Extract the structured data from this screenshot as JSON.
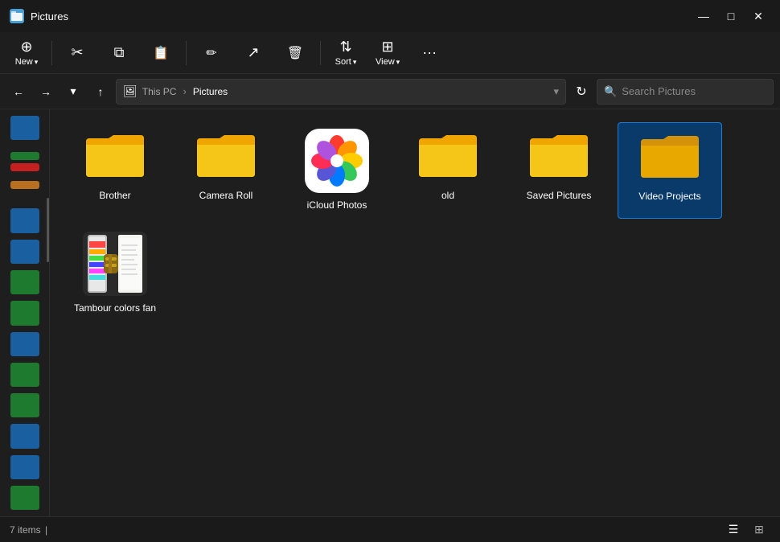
{
  "titleBar": {
    "title": "Pictures",
    "iconColor": "#4a9fd4",
    "controls": {
      "minimize": "—",
      "maximize": "□",
      "close": "✕"
    }
  },
  "toolbar": {
    "new_label": "New",
    "new_arrow": "▾",
    "cut_icon": "✂",
    "copy_icon": "⧉",
    "paste_icon": "📋",
    "rename_icon": "✏",
    "share_icon": "↗",
    "delete_icon": "🗑",
    "sort_label": "Sort",
    "sort_arrow": "▾",
    "view_label": "View",
    "view_arrow": "▾",
    "more_icon": "···"
  },
  "navBar": {
    "back_label": "←",
    "forward_label": "→",
    "recent_label": "▾",
    "up_label": "↑",
    "path": {
      "icon": "🖼",
      "parts": [
        "This PC",
        "Pictures"
      ]
    },
    "dropdown_arrow": "▾",
    "refresh_icon": "↻",
    "search_placeholder": "Search Pictures"
  },
  "sidebar": {
    "items": [
      {
        "icon": "📌",
        "name": "quick-access-1"
      },
      {
        "icon": "🏠",
        "name": "home"
      },
      {
        "icon": "⭐",
        "name": "favorites"
      },
      {
        "icon": "✕",
        "name": "close-item"
      },
      {
        "icon": "📁",
        "name": "folder"
      },
      {
        "icon": "🖥",
        "name": "desktop"
      },
      {
        "icon": "⬇",
        "name": "downloads"
      },
      {
        "icon": "📄",
        "name": "documents"
      },
      {
        "icon": "🖼",
        "name": "pictures"
      },
      {
        "icon": "🎵",
        "name": "music"
      },
      {
        "icon": "🎬",
        "name": "videos"
      },
      {
        "icon": "💾",
        "name": "this-pc"
      }
    ]
  },
  "files": [
    {
      "name": "Brother",
      "type": "folder",
      "selected": false
    },
    {
      "name": "Camera Roll",
      "type": "folder",
      "selected": false
    },
    {
      "name": "iCloud Photos",
      "type": "icloud",
      "selected": false
    },
    {
      "name": "old",
      "type": "folder",
      "selected": false
    },
    {
      "name": "Saved Pictures",
      "type": "folder",
      "selected": false
    },
    {
      "name": "Video Projects",
      "type": "folder",
      "selected": true
    },
    {
      "name": "Tambour colors fan",
      "type": "winrar",
      "selected": false
    }
  ],
  "statusBar": {
    "count": "7 items",
    "cursor": "|"
  },
  "colors": {
    "folderYellow": "#f5c842",
    "folderDark": "#e6a800",
    "folderSelected": "#e8b800",
    "accent": "#1a7fd4",
    "bg": "#1e1e1e"
  }
}
